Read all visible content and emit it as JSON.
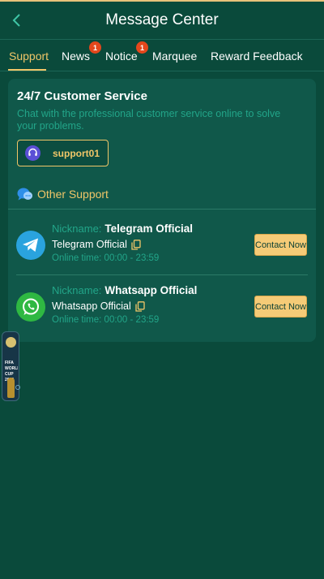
{
  "header": {
    "title": "Message Center",
    "back_icon": "chevron-left-icon"
  },
  "tabs": [
    {
      "label": "Support",
      "active": true
    },
    {
      "label": "News",
      "badge": "1"
    },
    {
      "label": "Notice",
      "badge": "1"
    },
    {
      "label": "Marquee"
    },
    {
      "label": "Reward Feedback"
    }
  ],
  "customer_service": {
    "title": "24/7 Customer Service",
    "description": "Chat with the professional customer service online to solve your problems.",
    "support_button": {
      "label": "support01",
      "icon": "headset-icon"
    }
  },
  "other_support": {
    "label": "Other Support",
    "icon": "chat-bubble-icon",
    "contacts": [
      {
        "nickname_label": "Nickname:",
        "nickname": "Telegram Official",
        "account": "Telegram Official",
        "online_time": "Online time: 00:00 - 23:59",
        "contact_label": "Contact Now",
        "icon": "telegram-icon",
        "icon_color": "#2aa3de"
      },
      {
        "nickname_label": "Nickname:",
        "nickname": "Whatsapp Official",
        "account": "Whatsapp Official",
        "online_time": "Online time: 00:00 - 23:59",
        "contact_label": "Contact Now",
        "icon": "whatsapp-icon",
        "icon_color": "#2fb842"
      }
    ]
  },
  "floating_badge": {
    "text": "FIFA WORLD CUP 2026"
  },
  "colors": {
    "background": "#0a4a3b",
    "card": "#10584a",
    "accent": "#f0c668",
    "muted_text": "#22a589",
    "badge": "#e4471c"
  }
}
